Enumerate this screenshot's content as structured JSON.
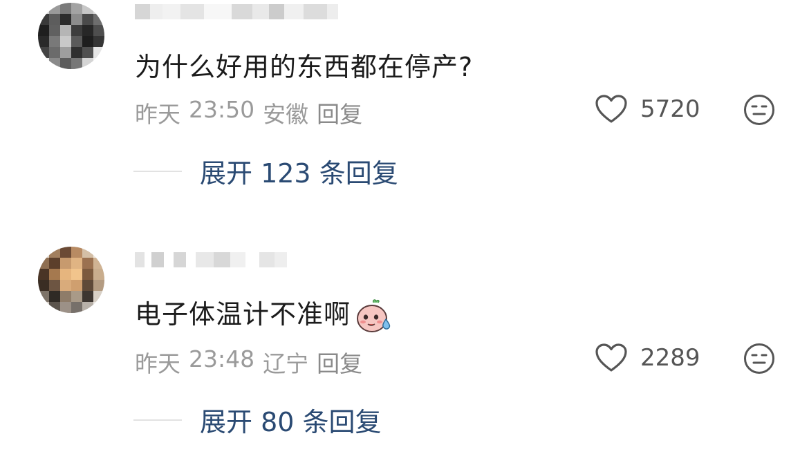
{
  "comments": [
    {
      "content": "为什么好用的东西都在停产?",
      "date": "昨天",
      "time": "23:50",
      "location": "安徽",
      "reply_label": "回复",
      "like_count": "5720",
      "expand_label": "展开 123 条回复",
      "sticker": ""
    },
    {
      "content": "电子体温计不准啊",
      "date": "昨天",
      "time": "23:48",
      "location": "辽宁",
      "reply_label": "回复",
      "like_count": "2289",
      "expand_label": "展开 80 条回复",
      "sticker": "sweating-face-sticker"
    }
  ],
  "colors": {
    "expand_link": "#2a4a73",
    "meta_text": "#9a9a9a",
    "content_text": "#1b1b1b"
  }
}
